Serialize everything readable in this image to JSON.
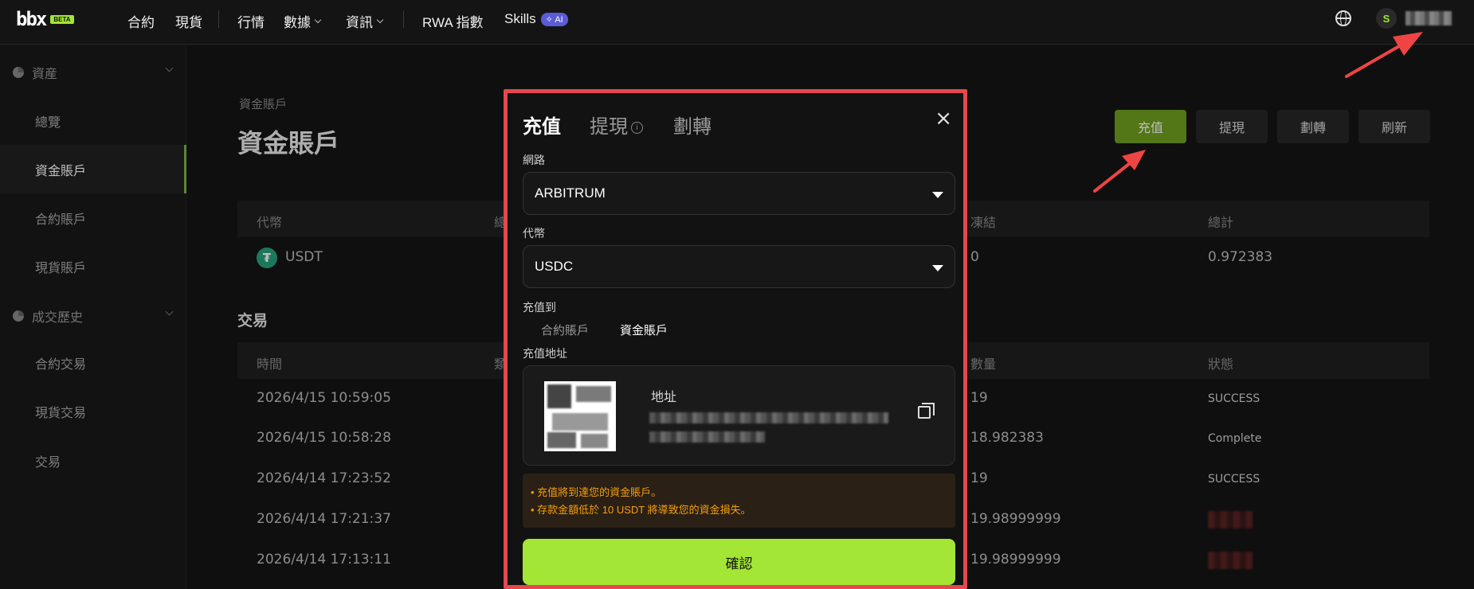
{
  "nav": {
    "logo_text": "bbx",
    "logo_badge": "BETA",
    "items": [
      "合約",
      "現貨",
      "行情",
      "數據",
      "資訊",
      "RWA 指數",
      "Skills"
    ],
    "skills_badge": "AI",
    "avatar_letter": "S"
  },
  "sidebar": {
    "group_assets": "資産",
    "items_assets": [
      "總覽",
      "資金賬戶",
      "合約賬戶",
      "現貨賬戶"
    ],
    "group_history": "成交歷史",
    "items_history": [
      "合約交易",
      "現貨交易",
      "交易"
    ]
  },
  "main": {
    "breadcrumb": "資金賬戶",
    "title": "資金賬戶",
    "actions": {
      "deposit": "充值",
      "withdraw": "提現",
      "transfer": "劃轉",
      "refresh": "刷新"
    },
    "balances": {
      "headers": {
        "token": "代幣",
        "col2": "總",
        "frozen": "凍結",
        "total": "總計"
      },
      "row": {
        "token": "USDT",
        "frozen": "0",
        "total": "0.972383"
      }
    },
    "trade_section": "交易",
    "trades": {
      "headers": {
        "time": "時間",
        "col2": "類",
        "amount": "數量",
        "status": "狀態"
      },
      "rows": [
        {
          "time": "2026/4/15 10:59:05",
          "amount": "19",
          "status": "SUCCESS"
        },
        {
          "time": "2026/4/15 10:58:28",
          "amount": "18.982383",
          "status": "Complete"
        },
        {
          "time": "2026/4/14 17:23:52",
          "amount": "19",
          "status": "SUCCESS"
        },
        {
          "time": "2026/4/14 17:21:37",
          "amount": "19.98999999",
          "status": ""
        },
        {
          "time": "2026/4/14 17:13:11",
          "amount": "19.98999999",
          "status": ""
        }
      ]
    }
  },
  "modal": {
    "tabs": {
      "deposit": "充值",
      "withdraw": "提現",
      "transfer": "劃轉"
    },
    "info_glyph": "i",
    "close_glyph": "×",
    "network_label": "網路",
    "network_value": "ARBITRUM",
    "token_label": "代幣",
    "token_value": "USDC",
    "deposit_to_label": "充值到",
    "deposit_to_options": [
      "合約賬戶",
      "資金賬戶"
    ],
    "address_section_label": "充值地址",
    "address_label": "地址",
    "warnings": [
      "充值將到達您的資金賬戶。",
      "存款金額低於 10 USDT 將導致您的資金損失。"
    ],
    "confirm": "確認"
  },
  "colors": {
    "accent": "#a3e635",
    "primary_button": "#6f9e1e",
    "annotation": "#ef4444",
    "warning": "#f59e0b"
  }
}
